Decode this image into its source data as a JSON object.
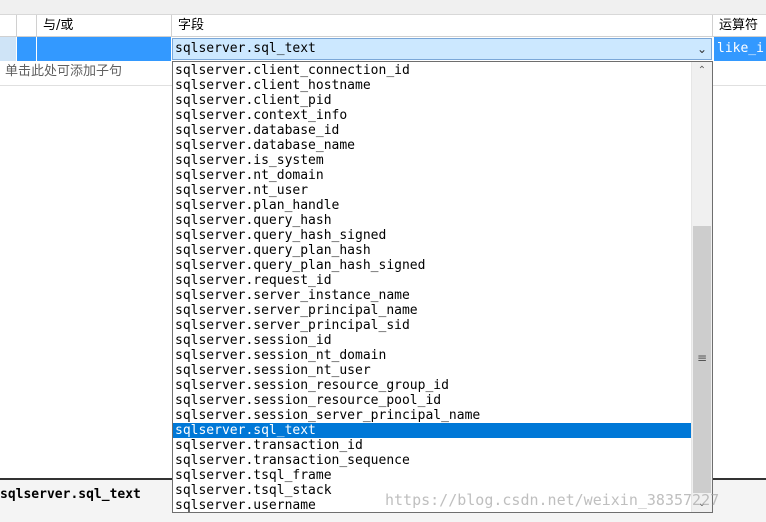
{
  "header": {
    "and_or_label": "与/或",
    "field_label": "字段",
    "operator_label": "运算符"
  },
  "row": {
    "field_value": "sqlserver.sql_text",
    "operator_value": "like_i"
  },
  "hint": "单击此处可添加子句",
  "expression": "sqlserver.sql_text",
  "watermark": "https://blog.csdn.net/weixin_38357227",
  "dropdown": {
    "selected_index": 24,
    "items": [
      "sqlserver.client_connection_id",
      "sqlserver.client_hostname",
      "sqlserver.client_pid",
      "sqlserver.context_info",
      "sqlserver.database_id",
      "sqlserver.database_name",
      "sqlserver.is_system",
      "sqlserver.nt_domain",
      "sqlserver.nt_user",
      "sqlserver.plan_handle",
      "sqlserver.query_hash",
      "sqlserver.query_hash_signed",
      "sqlserver.query_plan_hash",
      "sqlserver.query_plan_hash_signed",
      "sqlserver.request_id",
      "sqlserver.server_instance_name",
      "sqlserver.server_principal_name",
      "sqlserver.server_principal_sid",
      "sqlserver.session_id",
      "sqlserver.session_nt_domain",
      "sqlserver.session_nt_user",
      "sqlserver.session_resource_group_id",
      "sqlserver.session_resource_pool_id",
      "sqlserver.session_server_principal_name",
      "sqlserver.sql_text",
      "sqlserver.transaction_id",
      "sqlserver.transaction_sequence",
      "sqlserver.tsql_frame",
      "sqlserver.tsql_stack",
      "sqlserver.username"
    ],
    "scroll_up_icon": "chevron-up-icon",
    "scroll_down_icon": "chevron-down-icon",
    "scroll_grip_icon": "grip-icon"
  },
  "colors": {
    "selection": "#0078d7",
    "row_highlight": "#3399ff",
    "combo_background": "#cce8ff"
  }
}
